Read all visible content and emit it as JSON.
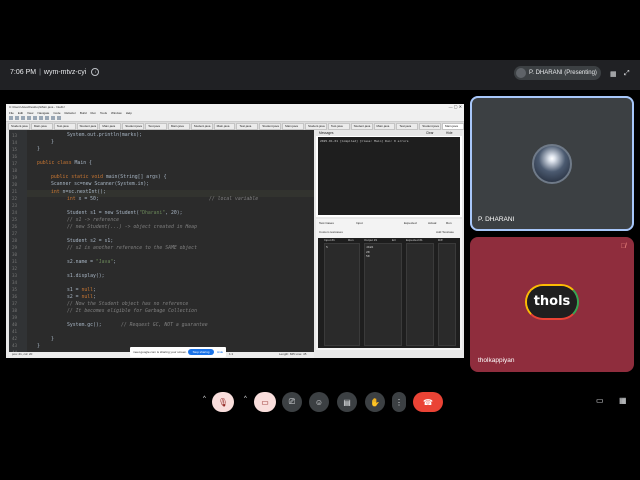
{
  "meeting": {
    "time": "7:06 PM",
    "separator": "|",
    "code": "wym-mtvz-cyi",
    "info_icon": "i",
    "presenter": "P. DHARANI (Presenting)"
  },
  "ide": {
    "window_title": "C:\\Users\\Java\\Desktop\\Main.java - IntelliJ",
    "menu": [
      "File",
      "Edit",
      "View",
      "Navigate",
      "Code",
      "Refactor",
      "Build",
      "Run",
      "Tools",
      "Window",
      "Help"
    ],
    "tabs": [
      "Student.java",
      "Main.java",
      "Test.java",
      "Student.java",
      "Main.java",
      "Student.java",
      "Test.java",
      "Main.java",
      "Student.java",
      "Main.java",
      "Test.java",
      "Student.java",
      "Main.java",
      "Student.java",
      "Test.java",
      "Student.java",
      "Main.java",
      "Test.java",
      "Student.java",
      "Main.java"
    ],
    "line_numbers": [
      "13",
      "14",
      "15",
      "16",
      "17",
      "18",
      "19",
      "20",
      "21",
      "22",
      "23",
      "24",
      "25",
      "26",
      "27",
      "28",
      "29",
      "30",
      "31",
      "32",
      "33",
      "34",
      "35",
      "36",
      "37",
      "38",
      "39",
      "40",
      "41",
      "42",
      "43",
      "44",
      "45"
    ],
    "code": {
      "l1": "System.out.println(marks);",
      "l2": "}",
      "l3": "}",
      "l4_kw": "public class",
      "l4_rest": " Main {",
      "l5_kw": "public static void",
      "l5_rest": " main(String[] args) {",
      "l6": "Scanner sc=new Scanner(System.in);",
      "l7_kw": "int",
      "l7_rest": " n=sc.nextInt();",
      "l8_kw": "int",
      "l8_rest": " x = 50;",
      "l8_cm": "// local variable",
      "l9_a": "Student s1 = new Student(",
      "l9_str": "\"Dharani\"",
      "l9_b": ", 20);",
      "l10": "// s1 -> reference",
      "l11": "// new Student(...) -> object created in Heap",
      "l12": "Student s2 = s1;",
      "l13": "// s2 is another reference to the SAME object",
      "l14_a": "s2.name = ",
      "l14_str": "\"Java\"",
      "l14_b": ";",
      "l15": "s1.display();",
      "l16_a": "s1 = ",
      "l16_kw": "null",
      "l16_b": ";",
      "l17_a": "s2 = ",
      "l17_kw": "null",
      "l17_b": ";",
      "l18": "// Now the Student object has no reference",
      "l19": "// It becomes eligible for Garbage Collection",
      "l20": "System.gc();",
      "l20_cm": "// Request GC, NOT a guarantee",
      "l21": "}",
      "l22": "}"
    },
    "status_left": "pos: 21, col: 20",
    "status_mid": "1:1",
    "status_right": "Length: 845  Line: 45",
    "messages_title": "Messages",
    "messages_clear": "Clear",
    "messages_hide": "Hide",
    "messages_text": "2025-01-01 [Compiled] [Class: Main] Run: 0 errors",
    "tests_title": "Test Cases",
    "tests_tabs": [
      "Input",
      "Expected",
      "Actual",
      "Run"
    ],
    "tests_sub": "Custom testcases",
    "tests_add": "Add Testcase",
    "cols": [
      "Input #1",
      "Run",
      "Output #1",
      "Err",
      "Expected #1",
      "Diff"
    ],
    "cell_values": [
      "5",
      "JAVA",
      "20",
      "50"
    ],
    "notice_text": "meet.google.com is sharing your screen.",
    "notice_stop": "Stop sharing",
    "notice_hide": "Hide"
  },
  "participants": {
    "self_name": "P. DHARANI",
    "other_name": "tholkappiyan",
    "other_logo": "thols"
  },
  "icons": [
    "info-icon",
    "mic-off-icon",
    "camera-off-icon",
    "present-icon",
    "emoji-icon",
    "captions-icon",
    "raise-hand-icon",
    "more-icon",
    "end-call-icon",
    "chat-icon",
    "activities-icon"
  ]
}
